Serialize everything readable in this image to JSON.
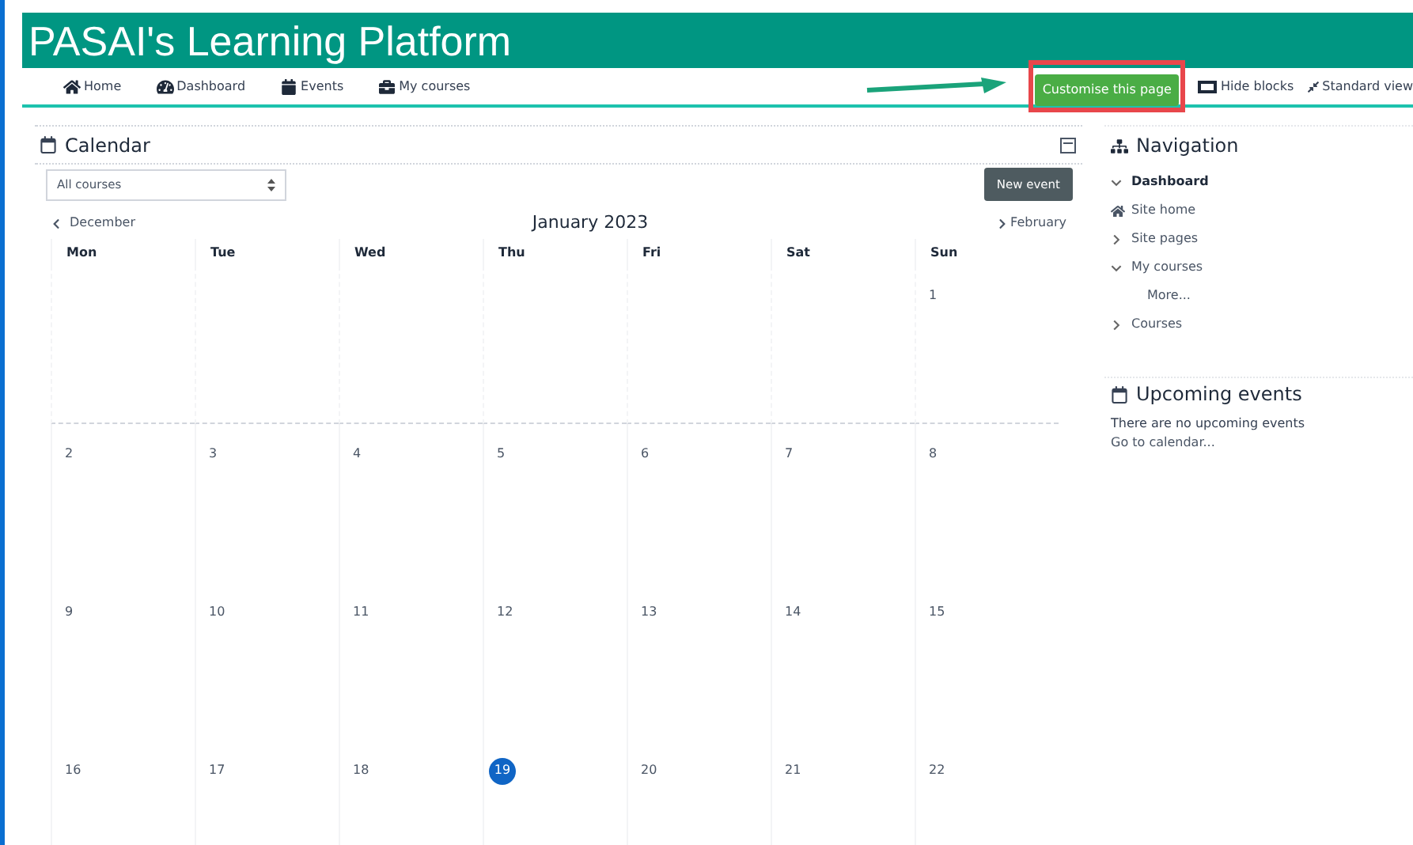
{
  "header": {
    "title": "PASAI's Learning Platform"
  },
  "nav": [
    {
      "label": "Home"
    },
    {
      "label": "Dashboard"
    },
    {
      "label": "Events"
    },
    {
      "label": "My courses"
    }
  ],
  "actions": {
    "customise": "Customise this page",
    "hide_blocks": "Hide blocks",
    "standard_view": "Standard view"
  },
  "calendar": {
    "title": "Calendar",
    "course_select": "All courses",
    "new_event": "New event",
    "prev": "December",
    "next": "February",
    "month": "January 2023",
    "weekdays": [
      "Mon",
      "Tue",
      "Wed",
      "Thu",
      "Fri",
      "Sat",
      "Sun"
    ],
    "weeks": [
      [
        {
          "day": "1",
          "today": false
        }
      ],
      [
        {
          "day": "2",
          "today": false
        },
        {
          "day": "3",
          "today": false
        },
        {
          "day": "4",
          "today": false
        },
        {
          "day": "5",
          "today": false
        },
        {
          "day": "6",
          "today": false
        },
        {
          "day": "7",
          "today": false
        },
        {
          "day": "8",
          "today": false
        }
      ],
      [
        {
          "day": "9",
          "today": false
        },
        {
          "day": "10",
          "today": false
        },
        {
          "day": "11",
          "today": false
        },
        {
          "day": "12",
          "today": false
        },
        {
          "day": "13",
          "today": false
        },
        {
          "day": "14",
          "today": false
        },
        {
          "day": "15",
          "today": false
        }
      ],
      [
        {
          "day": "16",
          "today": false
        },
        {
          "day": "17",
          "today": false
        },
        {
          "day": "18",
          "today": false
        },
        {
          "day": "19",
          "today": true
        },
        {
          "day": "20",
          "today": false
        },
        {
          "day": "21",
          "today": false
        },
        {
          "day": "22",
          "today": false
        }
      ]
    ]
  },
  "navigation": {
    "title": "Navigation",
    "items": [
      {
        "label": "Dashboard",
        "expanded": true,
        "children": [
          {
            "label": "Site home",
            "kind": "home"
          },
          {
            "label": "Site pages",
            "kind": "branch",
            "expanded": false
          },
          {
            "label": "My courses",
            "kind": "branch",
            "expanded": true,
            "children": [
              {
                "label": "More...",
                "kind": "leaf"
              }
            ]
          },
          {
            "label": "Courses",
            "kind": "branch",
            "expanded": false
          }
        ]
      }
    ]
  },
  "upcoming": {
    "title": "Upcoming events",
    "message": "There are no upcoming events",
    "link": "Go to calendar..."
  }
}
